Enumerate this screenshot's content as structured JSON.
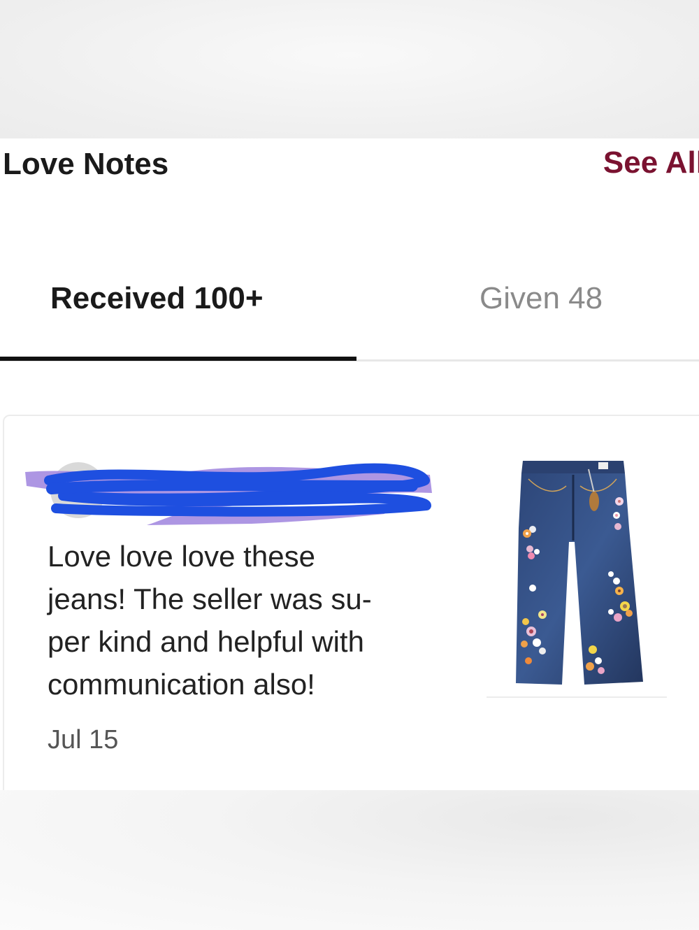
{
  "header": {
    "title": "Love Notes",
    "see_all_label": "See All"
  },
  "tabs": [
    {
      "label": "Received 100+",
      "active": true
    },
    {
      "label": "Given 48",
      "active": false
    }
  ],
  "note": {
    "text": "Love love love these jeans! The seller was su-per kind and helpful with communication also!",
    "lines": [
      "Love love love these",
      "jeans! The seller was su-",
      "per kind and helpful with",
      "communication also!"
    ],
    "date": "Jul 15",
    "product_icon": "flared-jeans-with-flowers"
  },
  "colors": {
    "accent": "#7a1230",
    "redaction_blue": "#1e4fe0",
    "redaction_purple": "#a48be0"
  }
}
